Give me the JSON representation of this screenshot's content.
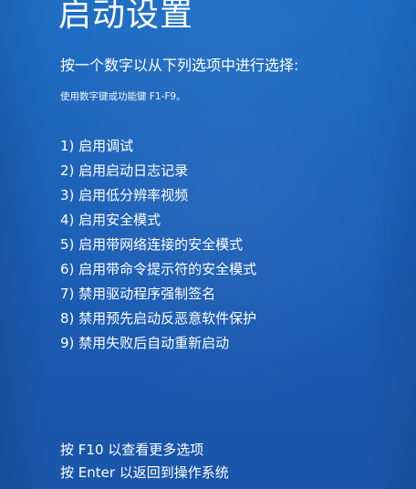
{
  "title": "启动设置",
  "prompt": "按一个数字以从下列选项中进行选择:",
  "hint": "使用数字键或功能键 F1-F9。",
  "options": [
    "1) 启用调试",
    "2) 启用启动日志记录",
    "3) 启用低分辨率视频",
    "4) 启用安全模式",
    "5) 启用带网络连接的安全模式",
    "6) 启用带命令提示符的安全模式",
    "7) 禁用驱动程序强制签名",
    "8) 禁用预先启动反恶意软件保护",
    "9) 禁用失败后自动重新启动"
  ],
  "footer": {
    "more_options": "按 F10 以查看更多选项",
    "return": "按 Enter 以返回到操作系统"
  },
  "colors": {
    "background": "#1d64bb",
    "text": "#ffffff"
  }
}
